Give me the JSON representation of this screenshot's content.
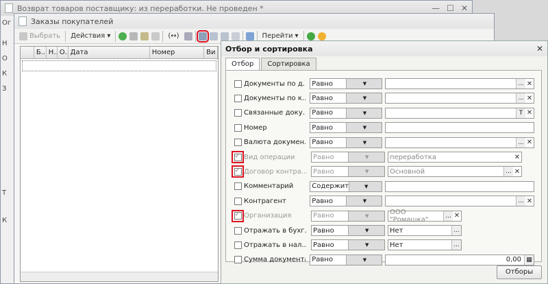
{
  "window1": {
    "title": "Возврат товаров поставщику: из переработки. Не проведен *",
    "left_strip": [
      "Ог",
      "Н",
      "О",
      "К",
      "З",
      "Т",
      "К"
    ]
  },
  "window2": {
    "title": "Заказы покупателей",
    "toolbar": {
      "select_label": "Выбрать",
      "actions_label": "Действия",
      "goto_label": "Перейти"
    },
    "columns": [
      "Б...",
      "Н...",
      "О...",
      "Дата",
      "Номер",
      "Ви"
    ]
  },
  "dialog": {
    "title": "Отбор и сортировка",
    "tabs": [
      "Отбор",
      "Сортировка"
    ],
    "rows": [
      {
        "label": "Документы по д...",
        "checked": false,
        "disabled": false,
        "cmp": "Равно",
        "value": "",
        "btn": "...",
        "x": true
      },
      {
        "label": "Документы по к...",
        "checked": false,
        "disabled": false,
        "cmp": "Равно",
        "value": "",
        "btn": "...",
        "x": true
      },
      {
        "label": "Связанные доку...",
        "checked": false,
        "disabled": false,
        "cmp": "Равно",
        "value": "",
        "btn": "T",
        "x": true
      },
      {
        "label": "Номер",
        "checked": false,
        "disabled": false,
        "cmp": "Равно",
        "value": "",
        "btn": "",
        "x": false
      },
      {
        "label": "Валюта докумен...",
        "checked": false,
        "disabled": false,
        "cmp": "Равно",
        "value": "",
        "btn": "...",
        "x": true
      },
      {
        "label": "Вид операции",
        "checked": true,
        "disabled": true,
        "cmp": "Равно",
        "value": "переработка",
        "btn": "",
        "x": true
      },
      {
        "label": "Договор контра...",
        "checked": true,
        "disabled": true,
        "cmp": "Равно",
        "value": "Основной",
        "btn": "...",
        "x": true
      },
      {
        "label": "Комментарий",
        "checked": false,
        "disabled": false,
        "cmp": "Содержит",
        "value": "",
        "btn": "",
        "x": false
      },
      {
        "label": "Контрагент",
        "checked": false,
        "disabled": false,
        "cmp": "Равно",
        "value": "",
        "btn": "...",
        "x": true
      },
      {
        "label": "Организация",
        "checked": true,
        "disabled": true,
        "cmp": "Равно",
        "value": "ООО \"Ромашка\"",
        "btn": "...",
        "x": true
      },
      {
        "label": "Отражать в бухг...",
        "checked": false,
        "disabled": false,
        "cmp": "Равно",
        "value": "Нет",
        "btn": "...",
        "x": false
      },
      {
        "label": "Отражать в нал...",
        "checked": false,
        "disabled": false,
        "cmp": "Равно",
        "value": "Нет",
        "btn": "...",
        "x": false
      },
      {
        "label": "Сумма документа",
        "checked": false,
        "disabled": false,
        "cmp": "Равно",
        "value": "0,00",
        "btn": "▦",
        "x": false
      }
    ],
    "footer_button": "Отборы"
  },
  "colors": {
    "highlight": "#d12222",
    "window_bg": "#f6f6f4"
  }
}
